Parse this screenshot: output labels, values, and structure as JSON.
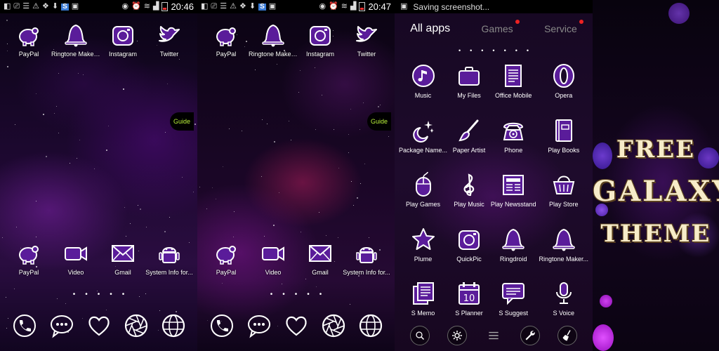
{
  "screens": {
    "home1": {
      "clock": "20:46",
      "top_icons": [
        {
          "label": "PayPal",
          "icon": "piggy-bank-icon"
        },
        {
          "label": "Ringtone Maker...",
          "icon": "bell-icon"
        },
        {
          "label": "Instagram",
          "icon": "camera-icon"
        },
        {
          "label": "Twitter",
          "icon": "bird-icon"
        }
      ],
      "bottom_icons": [
        {
          "label": "PayPal",
          "icon": "piggy-bank-icon"
        },
        {
          "label": "Video",
          "icon": "video-icon"
        },
        {
          "label": "Gmail",
          "icon": "mail-icon"
        },
        {
          "label": "System Info for...",
          "icon": "android-icon"
        }
      ],
      "guide_label": "Guide",
      "page_dots": "•••••",
      "dock": [
        "phone-icon",
        "chat-icon",
        "heart-icon",
        "aperture-icon",
        "browser-icon"
      ]
    },
    "home2": {
      "clock": "20:47",
      "top_icons": [
        {
          "label": "PayPal",
          "icon": "piggy-bank-icon"
        },
        {
          "label": "Ringtone Maker...",
          "icon": "bell-icon"
        },
        {
          "label": "Instagram",
          "icon": "camera-icon"
        },
        {
          "label": "Twitter",
          "icon": "bird-icon"
        }
      ],
      "bottom_icons": [
        {
          "label": "PayPal",
          "icon": "piggy-bank-icon"
        },
        {
          "label": "Video",
          "icon": "video-icon"
        },
        {
          "label": "Gmail",
          "icon": "mail-icon"
        },
        {
          "label": "System Info for...",
          "icon": "android-icon"
        }
      ],
      "guide_label": "Guide",
      "page_dots": "•••••",
      "dock": [
        "phone-icon",
        "chat-icon",
        "heart-icon",
        "aperture-icon",
        "browser-icon"
      ]
    },
    "drawer": {
      "status_text": "Saving screenshot...",
      "tabs": [
        {
          "label": "All apps",
          "active": true,
          "badge": false
        },
        {
          "label": "Games",
          "active": false,
          "badge": true
        },
        {
          "label": "Service",
          "active": false,
          "badge": true
        }
      ],
      "page_dots": "•••••••",
      "apps": [
        {
          "label": "Music",
          "icon": "music-icon"
        },
        {
          "label": "My Files",
          "icon": "briefcase-icon"
        },
        {
          "label": "Office Mobile",
          "icon": "document-icon"
        },
        {
          "label": "Opera",
          "icon": "opera-icon"
        },
        {
          "label": "Package Name...",
          "icon": "sparkle-moon-icon"
        },
        {
          "label": "Paper Artist",
          "icon": "brush-icon"
        },
        {
          "label": "Phone",
          "icon": "rotary-phone-icon"
        },
        {
          "label": "Play Books",
          "icon": "book-icon"
        },
        {
          "label": "Play Games",
          "icon": "mouse-icon"
        },
        {
          "label": "Play Music",
          "icon": "clef-icon"
        },
        {
          "label": "Play Newsstand",
          "icon": "newspaper-icon"
        },
        {
          "label": "Play Store",
          "icon": "basket-icon"
        },
        {
          "label": "Plume",
          "icon": "star-icon"
        },
        {
          "label": "QuickPic",
          "icon": "camera-icon"
        },
        {
          "label": "Ringdroid",
          "icon": "bell-icon"
        },
        {
          "label": "Ringtone Maker...",
          "icon": "bell-icon"
        },
        {
          "label": "S Memo",
          "icon": "memo-icon"
        },
        {
          "label": "S Planner",
          "icon": "calendar-icon"
        },
        {
          "label": "S Suggest",
          "icon": "speech-icon"
        },
        {
          "label": "S Voice",
          "icon": "microphone-icon"
        }
      ],
      "calendar_day": "10",
      "bottom_bar": [
        "search-icon",
        "settings-icon",
        "menu-icon",
        "wrench-icon",
        "broom-icon"
      ]
    }
  },
  "promo": {
    "line1": "FREE",
    "line2": "GALAXY",
    "line3": "THEME"
  },
  "colors": {
    "accent_purple": "#6a1fa8",
    "guide_text": "#b9f23a",
    "badge_red": "#e22222",
    "promo_text": "#f7ecc9"
  }
}
